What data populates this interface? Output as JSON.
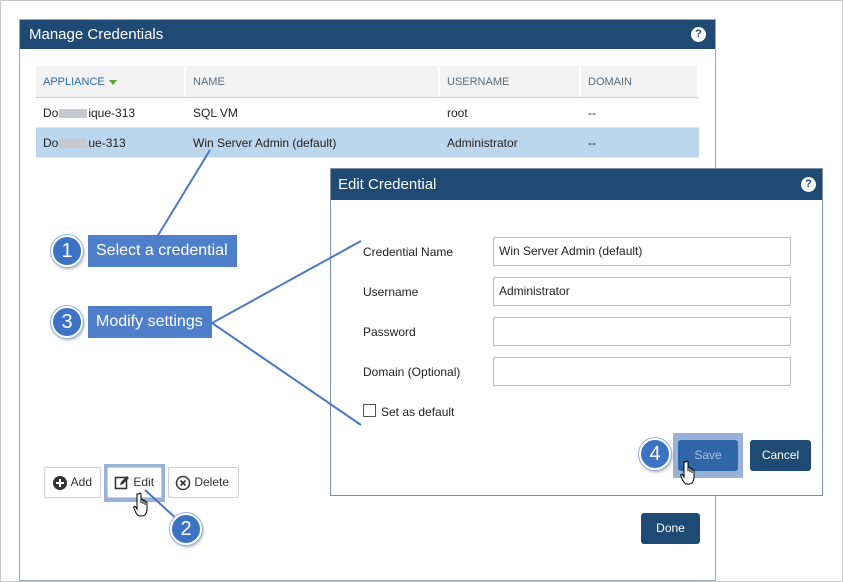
{
  "manage": {
    "title": "Manage Credentials",
    "help": "?",
    "columns": [
      "APPLIANCE",
      "NAME",
      "USERNAME",
      "DOMAIN"
    ],
    "rows": [
      {
        "appliance_a": "Do",
        "appliance_b": "ique-313",
        "name": "SQL VM",
        "username": "root",
        "domain": "--"
      },
      {
        "appliance_a": "Do",
        "appliance_b": "ue-313",
        "name": "Win Server Admin (default)",
        "username": "Administrator",
        "domain": "--"
      }
    ],
    "add_label": "Add",
    "edit_label": "Edit",
    "delete_label": "Delete",
    "done_label": "Done"
  },
  "edit": {
    "title": "Edit Credential",
    "help": "?",
    "name_label": "Credential Name",
    "name_value": "Win Server Admin (default)",
    "username_label": "Username",
    "username_value": "Administrator",
    "password_label": "Password",
    "password_value": "",
    "domain_label": "Domain (Optional)",
    "domain_value": "",
    "default_label": "Set as default",
    "default_checked": false,
    "save_label": "Save",
    "cancel_label": "Cancel"
  },
  "annotations": {
    "step1": "1",
    "step1_text": "Select a credential",
    "step2": "2",
    "step3": "3",
    "step3_text": "Modify settings",
    "step4": "4"
  },
  "colors": {
    "titlebar": "#1e4a73",
    "selected_row": "#bcd6ee",
    "callout": "#4f7fc9",
    "highlight": "#97b2d6"
  }
}
